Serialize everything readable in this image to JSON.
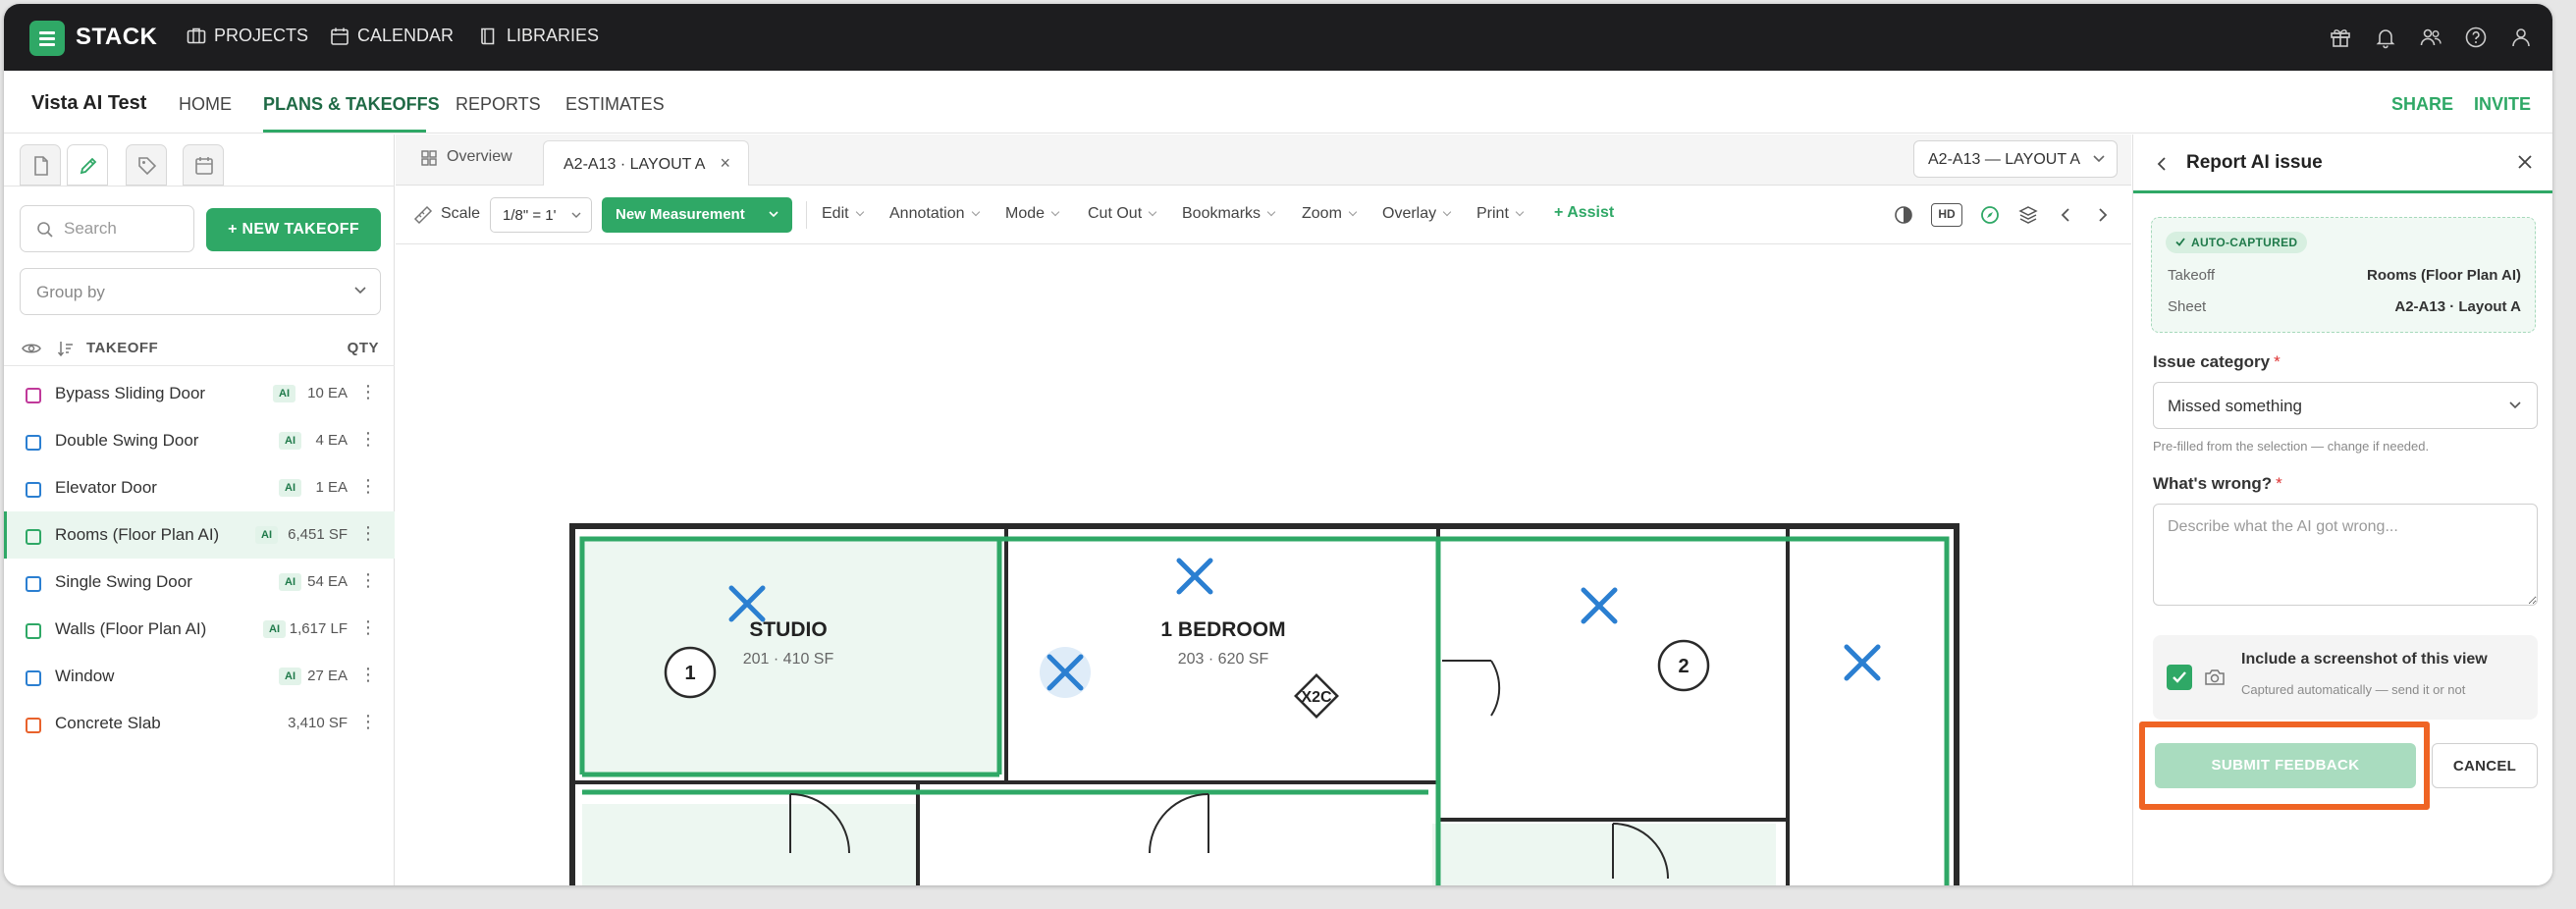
{
  "app": {
    "brand": "STACK"
  },
  "topnav": {
    "projects": "PROJECTS",
    "calendar": "CALENDAR",
    "libraries": "LIBRARIES"
  },
  "subnav": {
    "project": "Vista AI Test",
    "home": "HOME",
    "plans": "PLANS & TAKEOFFS",
    "reports": "REPORTS",
    "estimates": "ESTIMATES",
    "share": "SHARE",
    "invite": "INVITE"
  },
  "left": {
    "search_placeholder": "Search",
    "new_takeoff": "+ NEW TAKEOFF",
    "group_by": "Group by",
    "col_takeoff": "TAKEOFF",
    "col_qty": "QTY",
    "ai_badge": "AI",
    "items": [
      {
        "name": "Bypass Sliding Door",
        "qty": "10 EA",
        "ai": true,
        "color": "#c0399a"
      },
      {
        "name": "Double Swing Door",
        "qty": "4 EA",
        "ai": true,
        "color": "#2b7fd1"
      },
      {
        "name": "Elevator Door",
        "qty": "1 EA",
        "ai": true,
        "color": "#2b7fd1"
      },
      {
        "name": "Rooms (Floor Plan AI)",
        "qty": "6,451 SF",
        "ai": true,
        "color": "#2fa866"
      },
      {
        "name": "Single Swing Door",
        "qty": "54 EA",
        "ai": true,
        "color": "#2b7fd1"
      },
      {
        "name": "Walls (Floor Plan AI)",
        "qty": "1,617 LF",
        "ai": true,
        "color": "#2fa866"
      },
      {
        "name": "Window",
        "qty": "27 EA",
        "ai": true,
        "color": "#2b7fd1"
      },
      {
        "name": "Concrete Slab",
        "qty": "3,410 SF",
        "ai": false,
        "color": "#e8622c"
      }
    ]
  },
  "center": {
    "tab_overview": "Overview",
    "tab_active": "A2-A13 · LAYOUT A",
    "sheet_select": "A2-A13 — LAYOUT A",
    "toolbar": {
      "scale": "Scale",
      "scale_value": "1/8\" = 1'",
      "new_measurement": "New Measurement",
      "edit": "Edit",
      "annotation": "Annotation",
      "mode": "Mode",
      "cut_out": "Cut Out",
      "bookmarks": "Bookmarks",
      "zoom": "Zoom",
      "overlay": "Overlay",
      "print": "Print",
      "assist": "+ Assist",
      "hd": "HD"
    },
    "plan": {
      "studio": "STUDIO",
      "studio_sub": "201 · 410 SF",
      "bedroom": "1 BEDROOM",
      "bedroom_sub": "203 · 620 SF",
      "tag_1": "1",
      "tag_2": "2",
      "tag_x2c": "X2C"
    }
  },
  "right": {
    "title": "Report AI issue",
    "auto_captured": "AUTO-CAPTURED",
    "takeoff_label": "Takeoff",
    "takeoff_value": "Rooms (Floor Plan AI)",
    "sheet_label": "Sheet",
    "sheet_value": "A2-A13 · Layout A",
    "category_label": "Issue category",
    "required_mark": "*",
    "category_value": "Missed something",
    "category_hint": "Pre-filled from the selection — change if needed.",
    "wrong_label": "What's wrong?",
    "wrong_placeholder": "Describe what the AI got wrong...",
    "screenshot_title": "Include a screenshot of this view",
    "screenshot_sub": "Captured automatically — send it or not",
    "submit": "SUBMIT FEEDBACK",
    "cancel": "CANCEL"
  }
}
